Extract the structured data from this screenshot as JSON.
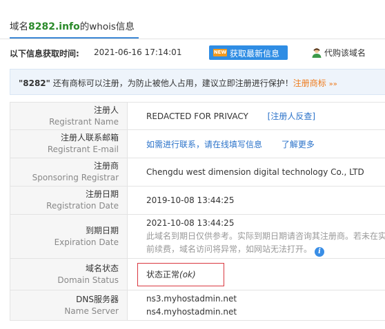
{
  "tab": {
    "prefix": "域名",
    "domain": "8282.info",
    "suffix": "的whois信息"
  },
  "info_row": {
    "label": "以下信息获取时间:",
    "time": "2021-06-16 17:14:01",
    "new_badge": "NEW",
    "refresh_label": "获取最新信息",
    "agent_label": "代购该域名"
  },
  "notice": {
    "quoted_name": "\"8282\"",
    "text": " 还有商标可以注册，为防止被他人占用，建议立即注册进行保护！",
    "link_label": "注册商标",
    "arrows": "»»"
  },
  "rows": [
    {
      "cn": "注册人",
      "en": "Registrant Name",
      "value": "REDACTED FOR PRIVACY",
      "link": "[注册人反查]"
    },
    {
      "cn": "注册人联系邮箱",
      "en": "Registrant E-mail",
      "link1": "如需进行联系，请在线填写信息",
      "link2": "了解更多"
    },
    {
      "cn": "注册商",
      "en": "Sponsoring Registrar",
      "value": "Chengdu west dimension digital technology Co., LTD"
    },
    {
      "cn": "注册日期",
      "en": "Registration Date",
      "value": "2019-10-08 13:44:25"
    },
    {
      "cn": "到期日期",
      "en": "Expiration Date",
      "value": "2021-10-08 13:44:25",
      "note_line1": "此域名到期日仅供参考。实际到期日期请咨询其注册商。若未在实际",
      "note_line2": "前续费，域名访问将异常，如网站无法打开。",
      "info_icon": "i"
    },
    {
      "cn": "域名状态",
      "en": "Domain Status",
      "value": "状态正常",
      "value_em": "(ok)"
    },
    {
      "cn": "DNS服务器",
      "en": "Name Server",
      "ns1": "ns3.myhostadmin.net",
      "ns2": "ns4.myhostadmin.net"
    }
  ],
  "colors": {
    "accent": "#2f8de4",
    "domain_green": "#2a8a2a",
    "link_blue": "#2a72c9",
    "orange": "#ee7a1b",
    "status_border": "#d9363e"
  },
  "icons": {
    "agent": "user-avatar-icon",
    "info": "info-circle-icon",
    "new": "new-badge-icon"
  }
}
